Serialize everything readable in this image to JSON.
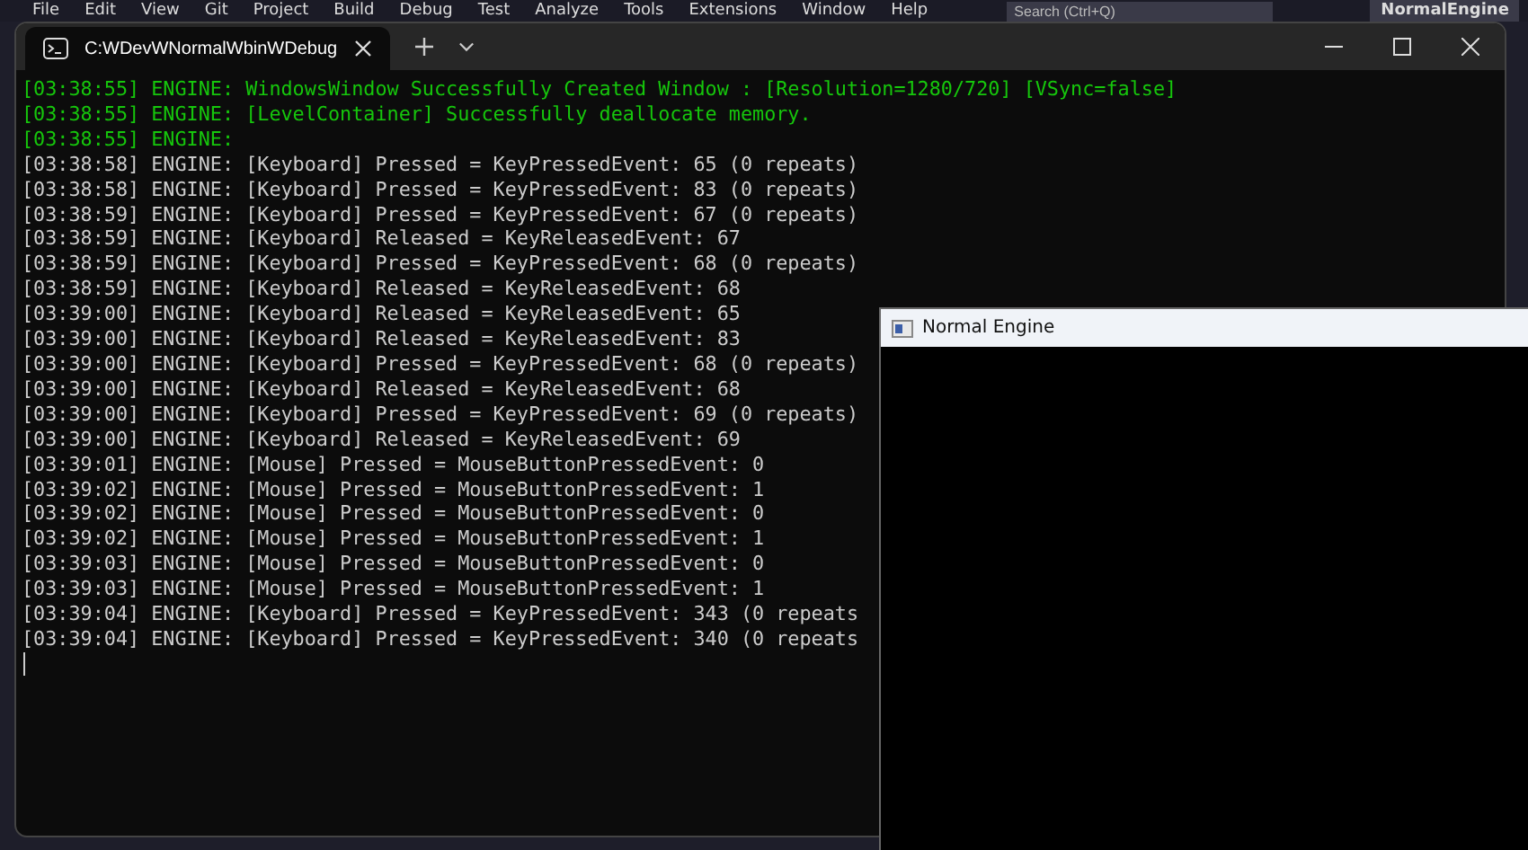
{
  "ide_menu": [
    "File",
    "Edit",
    "View",
    "Git",
    "Project",
    "Build",
    "Debug",
    "Test",
    "Analyze",
    "Tools",
    "Extensions",
    "Window",
    "Help"
  ],
  "ide_search": {
    "placeholder": "Search (Ctrl+Q)"
  },
  "ide_solution": "NormalEngine",
  "terminal": {
    "tab_title": "C:WDevWNormalWbinWDebug",
    "lines": [
      {
        "kind": "success",
        "text": "[03:38:55] ENGINE: WindowsWindow Successfully Created Window : [Resolution=1280/720] [VSync=false]"
      },
      {
        "kind": "success",
        "text": "[03:38:55] ENGINE: [LevelContainer] Successfully deallocate memory."
      },
      {
        "kind": "success",
        "text": "[03:38:55] ENGINE:"
      },
      {
        "kind": "info",
        "text": "[03:38:58] ENGINE: [Keyboard] Pressed = KeyPressedEvent: 65 (0 repeats)"
      },
      {
        "kind": "info",
        "text": "[03:38:58] ENGINE: [Keyboard] Pressed = KeyPressedEvent: 83 (0 repeats)"
      },
      {
        "kind": "info",
        "text": "[03:38:59] ENGINE: [Keyboard] Pressed = KeyPressedEvent: 67 (0 repeats)"
      },
      {
        "kind": "info",
        "text": "[03:38:59] ENGINE: [Keyboard] Released = KeyReleasedEvent: 67"
      },
      {
        "kind": "info",
        "text": "[03:38:59] ENGINE: [Keyboard] Pressed = KeyPressedEvent: 68 (0 repeats)"
      },
      {
        "kind": "info",
        "text": "[03:38:59] ENGINE: [Keyboard] Released = KeyReleasedEvent: 68"
      },
      {
        "kind": "info",
        "text": "[03:39:00] ENGINE: [Keyboard] Released = KeyReleasedEvent: 65"
      },
      {
        "kind": "info",
        "text": "[03:39:00] ENGINE: [Keyboard] Released = KeyReleasedEvent: 83"
      },
      {
        "kind": "info",
        "text": "[03:39:00] ENGINE: [Keyboard] Pressed = KeyPressedEvent: 68 (0 repeats)"
      },
      {
        "kind": "info",
        "text": "[03:39:00] ENGINE: [Keyboard] Released = KeyReleasedEvent: 68"
      },
      {
        "kind": "info",
        "text": "[03:39:00] ENGINE: [Keyboard] Pressed = KeyPressedEvent: 69 (0 repeats)"
      },
      {
        "kind": "info",
        "text": "[03:39:00] ENGINE: [Keyboard] Released = KeyReleasedEvent: 69"
      },
      {
        "kind": "info",
        "text": "[03:39:01] ENGINE: [Mouse] Pressed = MouseButtonPressedEvent: 0"
      },
      {
        "kind": "info",
        "text": "[03:39:02] ENGINE: [Mouse] Pressed = MouseButtonPressedEvent: 1"
      },
      {
        "kind": "info",
        "text": "[03:39:02] ENGINE: [Mouse] Pressed = MouseButtonPressedEvent: 0"
      },
      {
        "kind": "info",
        "text": "[03:39:02] ENGINE: [Mouse] Pressed = MouseButtonPressedEvent: 1"
      },
      {
        "kind": "info",
        "text": "[03:39:03] ENGINE: [Mouse] Pressed = MouseButtonPressedEvent: 0"
      },
      {
        "kind": "info",
        "text": "[03:39:03] ENGINE: [Mouse] Pressed = MouseButtonPressedEvent: 1"
      },
      {
        "kind": "info",
        "text": "[03:39:04] ENGINE: [Keyboard] Pressed = KeyPressedEvent: 343 (0 repeats"
      },
      {
        "kind": "info",
        "text": "[03:39:04] ENGINE: [Keyboard] Pressed = KeyPressedEvent: 340 (0 repeats"
      }
    ]
  },
  "game_window": {
    "title": "Normal Engine"
  }
}
